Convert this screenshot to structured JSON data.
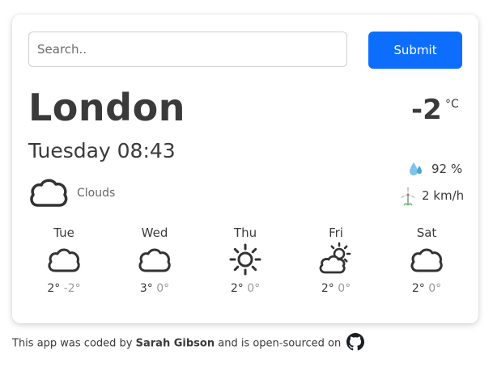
{
  "search": {
    "placeholder": "Search..",
    "value": "",
    "submit_label": "Submit"
  },
  "current": {
    "city": "London",
    "datetime": "Tuesday 08:43",
    "description": "Clouds",
    "description_icon": "cloud-icon",
    "temperature": "-2",
    "unit": "°C",
    "humidity": "92 %",
    "wind": "2 km/h"
  },
  "forecast": [
    {
      "day": "Tue",
      "icon": "cloud-icon",
      "max": "2°",
      "min": "-2°"
    },
    {
      "day": "Wed",
      "icon": "cloud-icon",
      "max": "3°",
      "min": "0°"
    },
    {
      "day": "Thu",
      "icon": "sun-icon",
      "max": "2°",
      "min": "0°"
    },
    {
      "day": "Fri",
      "icon": "partly-cloudy-icon",
      "max": "2°",
      "min": "0°"
    },
    {
      "day": "Sat",
      "icon": "cloud-icon",
      "max": "2°",
      "min": "0°"
    }
  ],
  "footer": {
    "prefix": "This app was coded by",
    "author": "Sarah Gibson",
    "suffix": "and is open-sourced on"
  },
  "colors": {
    "accent": "#0d6efd",
    "text": "#3a3a3a",
    "muted": "#9a9a9a"
  }
}
